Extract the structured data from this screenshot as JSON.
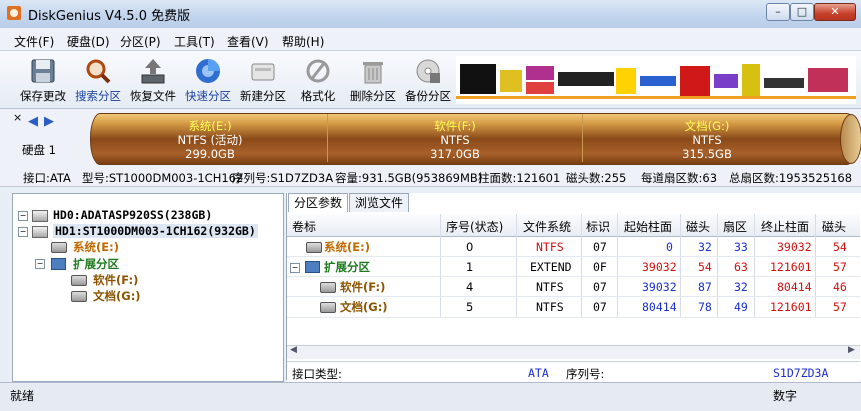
{
  "window": {
    "title": "DiskGenius V4.5.0 免费版",
    "buttons": {
      "minimize": "–",
      "maximize": "□",
      "close": "✕"
    }
  },
  "menu": [
    "文件(F)",
    "硬盘(D)",
    "分区(P)",
    "工具(T)",
    "查看(V)",
    "帮助(H)"
  ],
  "toolbar": [
    {
      "label": "保存更改",
      "icon": "save-icon"
    },
    {
      "label": "搜索分区",
      "icon": "search-partition-icon"
    },
    {
      "label": "恢复文件",
      "icon": "recover-files-icon"
    },
    {
      "label": "快速分区",
      "icon": "quick-partition-icon"
    },
    {
      "label": "新建分区",
      "icon": "new-partition-icon"
    },
    {
      "label": "格式化",
      "icon": "format-icon"
    },
    {
      "label": "删除分区",
      "icon": "delete-partition-icon"
    },
    {
      "label": "备份分区",
      "icon": "backup-partition-icon"
    }
  ],
  "disk_bar": {
    "label": "硬盘 1",
    "segments": [
      {
        "name": "系统(E:)",
        "fs": "NTFS (活动)",
        "size": "299.0GB"
      },
      {
        "name": "软件(F:)",
        "fs": "NTFS",
        "size": "317.0GB"
      },
      {
        "name": "文档(G:)",
        "fs": "NTFS",
        "size": "315.5GB"
      }
    ]
  },
  "disk_info": {
    "interface": "接口:ATA",
    "model": "型号:ST1000DM003-1CH162",
    "serial": "序列号:S1D7ZD3A",
    "capacity": "容量:931.5GB(953869MB)",
    "cylinders": "柱面数:121601",
    "heads": "磁头数:255",
    "sectors_per_track": "每道扇区数:63",
    "total_sectors": "总扇区数:1953525168"
  },
  "tree": [
    {
      "label": "HD0:ADATASP920SS(238GB)"
    },
    {
      "label": "HD1:ST1000DM003-1CH162(932GB)"
    },
    {
      "label": "系统(E:)"
    },
    {
      "label": "扩展分区"
    },
    {
      "label": "软件(F:)"
    },
    {
      "label": "文档(G:)"
    }
  ],
  "tabs": [
    "分区参数",
    "浏览文件"
  ],
  "columns": [
    "卷标",
    "序号(状态)",
    "文件系统",
    "标识",
    "起始柱面",
    "磁头",
    "扇区",
    "终止柱面",
    "磁头"
  ],
  "rows": [
    {
      "label": "系统(E:)",
      "seq": "0",
      "fs": "NTFS",
      "id": "07",
      "start_cyl": "0",
      "head": "32",
      "sector": "33",
      "end_cyl": "39032",
      "end_head": "54"
    },
    {
      "label": "扩展分区",
      "seq": "1",
      "fs": "EXTEND",
      "id": "0F",
      "start_cyl": "39032",
      "head": "54",
      "sector": "63",
      "end_cyl": "121601",
      "end_head": "57"
    },
    {
      "label": "软件(F:)",
      "seq": "4",
      "fs": "NTFS",
      "id": "07",
      "start_cyl": "39032",
      "head": "87",
      "sector": "32",
      "end_cyl": "80414",
      "end_head": "46"
    },
    {
      "label": "文档(G:)",
      "seq": "5",
      "fs": "NTFS",
      "id": "07",
      "start_cyl": "80414",
      "head": "78",
      "sector": "49",
      "end_cyl": "121601",
      "end_head": "57"
    }
  ],
  "detail": {
    "interface_type_label": "接口类型:",
    "interface_type_value": "ATA",
    "serial_label": "序列号:",
    "serial_value": "S1D7ZD3A"
  },
  "status": {
    "left": "就绪",
    "right": "数字"
  },
  "colors": {
    "partition_bar": "#a8602a",
    "segment_name": "#ffff55",
    "cell_red": "#d01010",
    "cell_blue": "#1a2fd0"
  }
}
